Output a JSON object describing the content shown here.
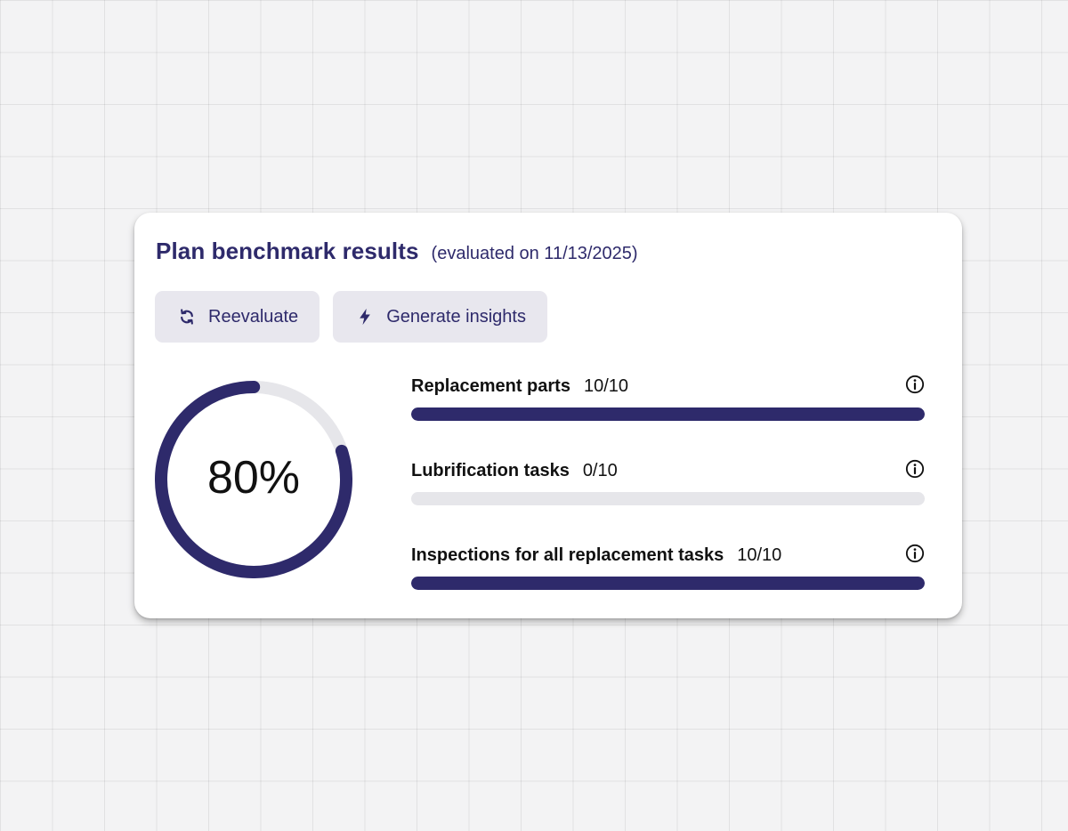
{
  "card": {
    "title": "Plan benchmark results",
    "subtitle": "(evaluated on 11/13/2025)"
  },
  "actions": {
    "reevaluate": {
      "label": "Reevaluate",
      "icon": "refresh-icon"
    },
    "generate": {
      "label": "Generate insights",
      "icon": "lightning-icon"
    }
  },
  "score": {
    "label": "80%",
    "value": 0.8
  },
  "metrics": [
    {
      "name": "Replacement parts",
      "score": "10/10",
      "fraction": 1.0,
      "icon": "info-icon"
    },
    {
      "name": "Lubrification tasks",
      "score": "0/10",
      "fraction": 0.0,
      "icon": "info-icon"
    },
    {
      "name": "Inspections for all replacement tasks",
      "score": "10/10",
      "fraction": 1.0,
      "icon": "info-icon"
    }
  ],
  "colors": {
    "accent": "#2e2a6b",
    "track": "#e6e6ea",
    "button_bg": "#e8e7ee",
    "page_bg": "#f3f3f4"
  }
}
